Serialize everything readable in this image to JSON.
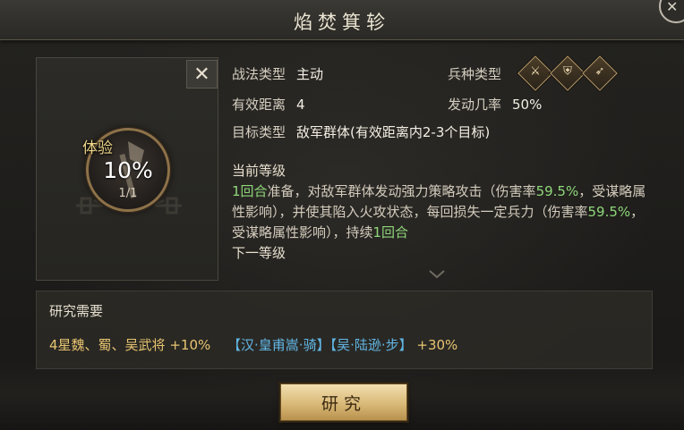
{
  "window": {
    "title": "焰焚箕轸",
    "corner_glyph": "✕"
  },
  "skill": {
    "close_glyph": "✕",
    "exp_label": "体验",
    "progress_text": "10%",
    "progress": 0.1,
    "level_text": "1/1",
    "icon": "axe-icon"
  },
  "info": {
    "tactic_type_label": "战法类型",
    "tactic_type_value": "主动",
    "range_label": "有效距离",
    "range_value": "4",
    "target_label": "目标类型",
    "target_value": "敌军群体(有效距离内2-3个目标)",
    "troop_type_label": "兵种类型",
    "troop_icons": [
      "cavalry-icon",
      "shield-icon",
      "archer-icon"
    ],
    "trigger_label": "发动几率",
    "trigger_value": "50%"
  },
  "description": {
    "current_level_label": "当前等级",
    "rounds1": "1回合",
    "text1": "准备，对敌军群体发动强力策略攻击（伤害率",
    "rate1": "59.5%",
    "text2": "，受谋略属性影响），并使其陷入火攻状态，每回损失一定兵力（伤害率",
    "rate2": "59.5%",
    "text3": "，受谋略属性影响），持续",
    "rounds2": "1回合",
    "next_level_label": "下一等级"
  },
  "research": {
    "title": "研究需要",
    "req1": "4星魏、蜀、吴武将",
    "req1_bonus": "+10%",
    "req2": "【汉·皇甫嵩·骑】",
    "req3": "【吴·陆逊·步】",
    "req23_bonus": "+30%",
    "button_label": "研究"
  },
  "colors": {
    "highlight_green": "#8fd77a",
    "gold_text": "#e8c571",
    "hero_blue": "#62b7e6",
    "button_gold": "#d9b977"
  }
}
